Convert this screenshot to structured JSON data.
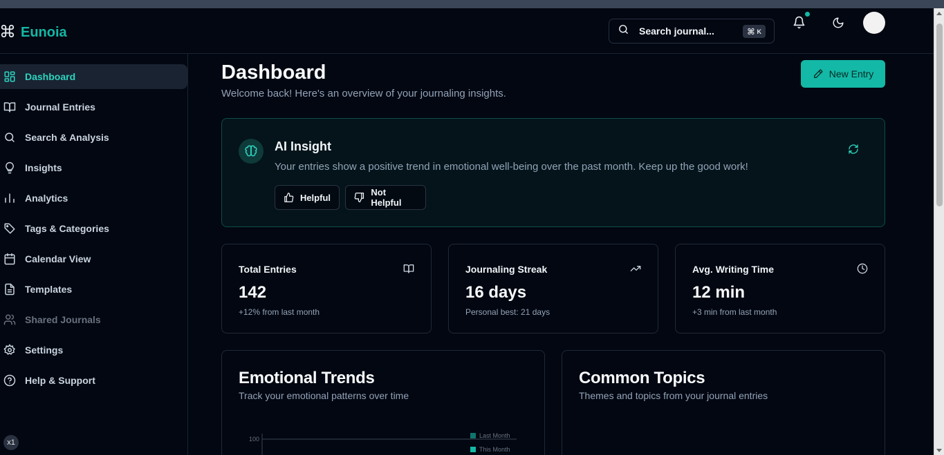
{
  "header": {
    "brand": "Eunoia",
    "search_placeholder": "Search journal...",
    "shortcut_symbol": "⌘",
    "shortcut_key": "K"
  },
  "sidebar": {
    "items": [
      {
        "label": "Dashboard",
        "icon": "dashboard-icon",
        "active": true
      },
      {
        "label": "Journal Entries",
        "icon": "book-icon"
      },
      {
        "label": "Search & Analysis",
        "icon": "search-icon"
      },
      {
        "label": "Insights",
        "icon": "lightbulb-icon"
      },
      {
        "label": "Analytics",
        "icon": "bar-chart-icon"
      },
      {
        "label": "Tags & Categories",
        "icon": "tag-icon"
      },
      {
        "label": "Calendar View",
        "icon": "calendar-icon"
      },
      {
        "label": "Templates",
        "icon": "file-icon"
      },
      {
        "label": "Shared Journals",
        "icon": "users-icon",
        "muted": true
      },
      {
        "label": "Settings",
        "icon": "gear-icon"
      },
      {
        "label": "Help & Support",
        "icon": "help-icon"
      }
    ],
    "zoom_badge": "x1"
  },
  "main": {
    "title": "Dashboard",
    "subtitle": "Welcome back! Here's an overview of your journaling insights.",
    "new_entry_label": "New Entry",
    "insight": {
      "title": "AI Insight",
      "message": "Your entries show a positive trend in emotional well-being over the past month. Keep up the good work!",
      "helpful_label": "Helpful",
      "not_helpful_label": "Not Helpful"
    },
    "stats": [
      {
        "title": "Total Entries",
        "value": "142",
        "note": "+12% from last month",
        "icon": "book-open-icon"
      },
      {
        "title": "Journaling Streak",
        "value": "16 days",
        "note": "Personal best: 21 days",
        "icon": "trending-up-icon"
      },
      {
        "title": "Avg. Writing Time",
        "value": "12 min",
        "note": "+3 min from last month",
        "icon": "clock-icon"
      }
    ],
    "emotional_trends": {
      "title": "Emotional Trends",
      "subtitle": "Track your emotional patterns over time",
      "y_tick": "100",
      "legend": [
        "Last Month",
        "This Month"
      ]
    },
    "common_topics": {
      "title": "Common Topics",
      "subtitle": "Themes and topics from your journal entries"
    }
  },
  "colors": {
    "accent": "#14b8a6",
    "background": "#020711",
    "legend_last_month": "#0f766e",
    "legend_this_month": "#14b8a6"
  }
}
